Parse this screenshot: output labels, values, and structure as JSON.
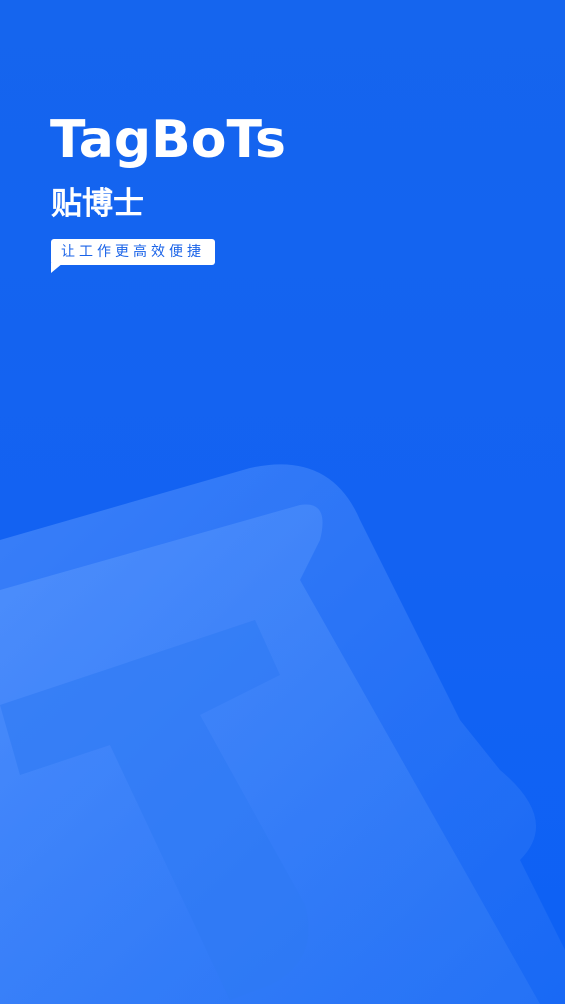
{
  "splash": {
    "app_name": "TagBoTs",
    "app_name_cn": "贴博士",
    "slogan": "让工作更高效便捷"
  },
  "colors": {
    "background": "#1565ee",
    "text": "#ffffff",
    "slogan_text": "#1a63e8",
    "bubble": "#ffffff"
  },
  "icons": {
    "watermark": "tag-letter-t-icon"
  }
}
